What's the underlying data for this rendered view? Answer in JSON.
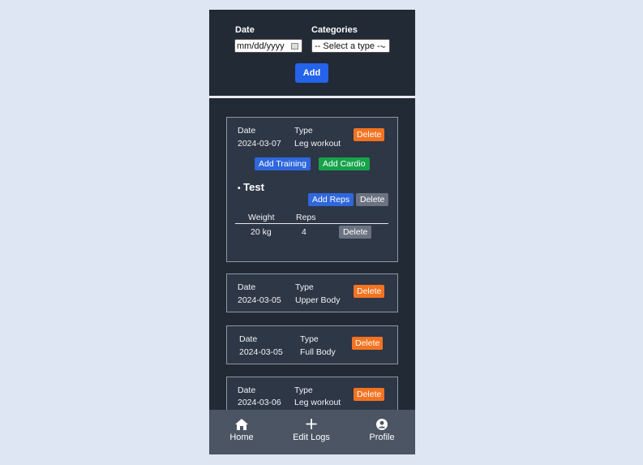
{
  "form": {
    "date_label": "Date",
    "date_placeholder": "mm/dd/yyyy",
    "categories_label": "Categories",
    "categories_selected": "-- Select a type --",
    "add_label": "Add"
  },
  "logs": [
    {
      "date_label": "Date",
      "date": "2024-03-07",
      "type_label": "Type",
      "type": "Leg workout",
      "delete_label": "Delete",
      "add_training_label": "Add Training",
      "add_cardio_label": "Add Cardio",
      "exercise": {
        "name": "Test",
        "add_reps_label": "Add Reps",
        "delete_label": "Delete",
        "columns": [
          "Weight",
          "Reps"
        ],
        "rows": [
          {
            "weight": "20 kg",
            "reps": "4",
            "delete_label": "Delete"
          }
        ]
      }
    },
    {
      "date_label": "Date",
      "date": "2024-03-05",
      "type_label": "Type",
      "type": "Upper Body",
      "delete_label": "Delete"
    },
    {
      "date_label": "Date",
      "date": "2024-03-05",
      "type_label": "Type",
      "type": "Full Body",
      "delete_label": "Delete"
    },
    {
      "date_label": "Date",
      "date": "2024-03-06",
      "type_label": "Type",
      "type": "Leg workout",
      "delete_label": "Delete"
    }
  ],
  "nav": {
    "home_label": "Home",
    "edit_label": "Edit Logs",
    "profile_label": "Profile"
  },
  "colors": {
    "page_bg": "#dfe6f3",
    "panel_bg": "#222a36",
    "delete": "#f47321",
    "primary": "#2563eb",
    "cardio": "#16a34a",
    "nav_bg": "#4b5563"
  }
}
